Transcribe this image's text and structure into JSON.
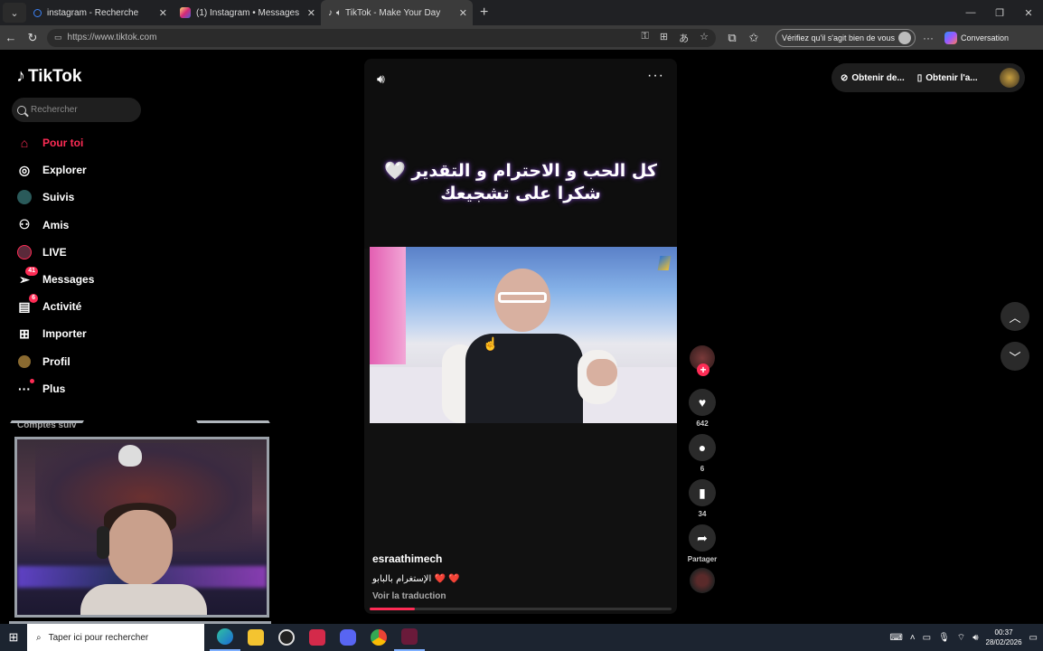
{
  "browser": {
    "tabs": [
      {
        "title": "instagram - Recherche",
        "icon_color": "#3b82f6"
      },
      {
        "title": "(1) Instagram • Messages",
        "icon_color": "#e1306c"
      },
      {
        "title": "TikTok - Make Your Day",
        "icon_color": "#ffffff"
      }
    ],
    "url": "https://www.tiktok.com",
    "verify_label": "Vérifiez qu'il s'agit bien de vous",
    "conversation_label": "Conversation"
  },
  "tiktok": {
    "logo": "TikTok",
    "search_placeholder": "Rechercher",
    "nav": [
      {
        "label": "Pour toi",
        "icon": "home-icon"
      },
      {
        "label": "Explorer",
        "icon": "compass-icon"
      },
      {
        "label": "Suivis",
        "icon": "following-icon"
      },
      {
        "label": "Amis",
        "icon": "friends-icon"
      },
      {
        "label": "LIVE",
        "icon": "live-icon"
      },
      {
        "label": "Messages",
        "icon": "messages-icon",
        "badge": "41"
      },
      {
        "label": "Activité",
        "icon": "activity-icon",
        "badge": "6"
      },
      {
        "label": "Importer",
        "icon": "upload-icon"
      },
      {
        "label": "Profil",
        "icon": "profile-icon"
      },
      {
        "label": "Plus",
        "icon": "more-icon"
      }
    ],
    "following_accounts_label": "Comptes suiv",
    "top_right": {
      "get_coins": "Obtenir de...",
      "get_app": "Obtenir l'a..."
    },
    "video": {
      "caption_line1": "كل الحب و الاحترام و التقدير 🤍",
      "caption_line2": "شكرا على تشجيعك",
      "username": "esraathimech",
      "description": "الإستغرام بالبابو ❤️ ❤️",
      "translate_label": "Voir la traduction",
      "progress": 0.15
    },
    "actions": {
      "likes": "642",
      "comments": "6",
      "saves": "34",
      "share_label": "Partager"
    },
    "accent_color": "#fe2c55"
  },
  "taskbar": {
    "search_placeholder": "Taper ici pour rechercher",
    "time": "00:37",
    "date": "28/02/2026"
  }
}
